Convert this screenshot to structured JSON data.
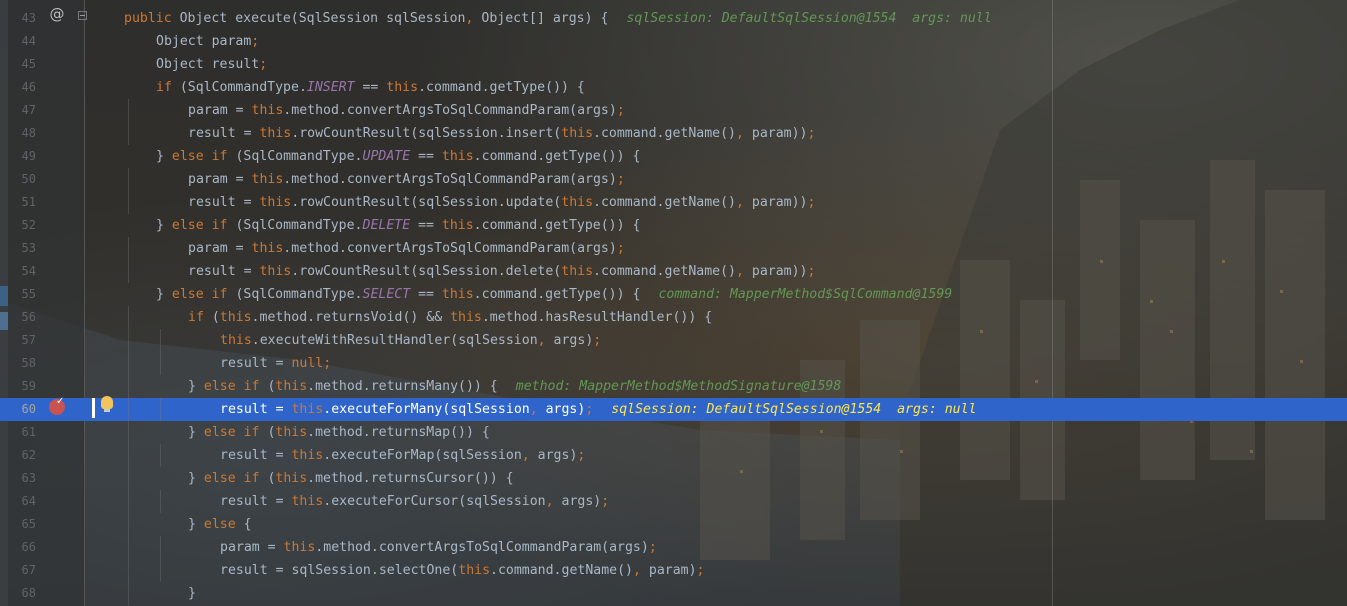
{
  "editor": {
    "colors": {
      "current_line": "#2f65ca",
      "keyword": "#cc7832",
      "constant": "#9876aa",
      "method": "#ffc66d",
      "hint": "#629755",
      "text": "#a9b7c6",
      "breakpoint": "#c75450"
    },
    "icons": {
      "override": "at-sign-icon",
      "fold": "fold-minus-icon",
      "breakpoint": "breakpoint-icon",
      "intention": "lightbulb-icon"
    },
    "override_glyph": "@",
    "breakpoint_glyph": "✓",
    "current_line_number": 60,
    "lines": [
      {
        "n": "43",
        "code": "public Object execute(SqlSession sqlSession, Object[] args) {",
        "hint": "sqlSession: DefaultSqlSession@1554  args: null"
      },
      {
        "n": "44",
        "code": "Object param;"
      },
      {
        "n": "45",
        "code": "Object result;"
      },
      {
        "n": "46",
        "code": "if (SqlCommandType.INSERT == this.command.getType()) {"
      },
      {
        "n": "47",
        "code": "param = this.method.convertArgsToSqlCommandParam(args);"
      },
      {
        "n": "48",
        "code": "result = this.rowCountResult(sqlSession.insert(this.command.getName(), param));"
      },
      {
        "n": "49",
        "code": "} else if (SqlCommandType.UPDATE == this.command.getType()) {"
      },
      {
        "n": "50",
        "code": "param = this.method.convertArgsToSqlCommandParam(args);"
      },
      {
        "n": "51",
        "code": "result = this.rowCountResult(sqlSession.update(this.command.getName(), param));"
      },
      {
        "n": "52",
        "code": "} else if (SqlCommandType.DELETE == this.command.getType()) {"
      },
      {
        "n": "53",
        "code": "param = this.method.convertArgsToSqlCommandParam(args);"
      },
      {
        "n": "54",
        "code": "result = this.rowCountResult(sqlSession.delete(this.command.getName(), param));"
      },
      {
        "n": "55",
        "code": "} else if (SqlCommandType.SELECT == this.command.getType()) {",
        "hint": "command: MapperMethod$SqlCommand@1599"
      },
      {
        "n": "56",
        "code": "if (this.method.returnsVoid() && this.method.hasResultHandler()) {"
      },
      {
        "n": "57",
        "code": "this.executeWithResultHandler(sqlSession, args);"
      },
      {
        "n": "58",
        "code": "result = null;"
      },
      {
        "n": "59",
        "code": "} else if (this.method.returnsMany()) {",
        "hint": "method: MapperMethod$MethodSignature@1598"
      },
      {
        "n": "60",
        "code": "result = this.executeForMany(sqlSession, args);",
        "hint": "sqlSession: DefaultSqlSession@1554  args: null"
      },
      {
        "n": "61",
        "code": "} else if (this.method.returnsMap()) {"
      },
      {
        "n": "62",
        "code": "result = this.executeForMap(sqlSession, args);"
      },
      {
        "n": "63",
        "code": "} else if (this.method.returnsCursor()) {"
      },
      {
        "n": "64",
        "code": "result = this.executeForCursor(sqlSession, args);"
      },
      {
        "n": "65",
        "code": "} else {"
      },
      {
        "n": "66",
        "code": "param = this.method.convertArgsToSqlCommandParam(args);"
      },
      {
        "n": "67",
        "code": "result = sqlSession.selectOne(this.command.getName(), param);"
      },
      {
        "n": "68",
        "code": "}"
      }
    ]
  }
}
